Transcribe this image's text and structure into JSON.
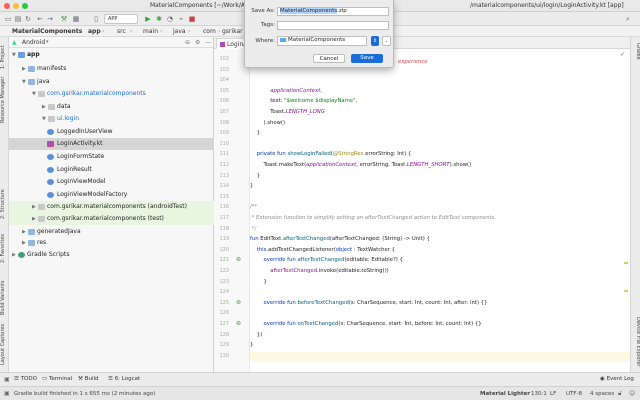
{
  "window": {
    "title": "MaterialComponents [~/Work/AndroidSample/M",
    "title_right": "/materialcomponents/ui/login/LoginActivity.kt [app]"
  },
  "toolbar": {
    "run_config": "APP"
  },
  "breadcrumb": [
    "MaterialComponents",
    "app",
    "src",
    "main",
    "java",
    "com",
    "gsrikar"
  ],
  "project_panel": {
    "view_selector": "Android",
    "tree": [
      {
        "label": "app",
        "depth": 0,
        "icon": "module-icon"
      },
      {
        "label": "manifests",
        "depth": 1,
        "icon": "folder-icon"
      },
      {
        "label": "java",
        "depth": 1,
        "icon": "folder-icon"
      },
      {
        "label": "com.gsrikar.materialcomponents",
        "depth": 2,
        "icon": "package-icon"
      },
      {
        "label": "data",
        "depth": 3,
        "icon": "folder-icon"
      },
      {
        "label": "ui.login",
        "depth": 3,
        "icon": "package-icon"
      },
      {
        "label": "LoggedInUserView",
        "depth": 4,
        "icon": "kotlin-class-icon"
      },
      {
        "label": "LoginActivity.kt",
        "depth": 4,
        "icon": "kotlin-file-icon"
      },
      {
        "label": "LoginFormState",
        "depth": 4,
        "icon": "kotlin-class-icon"
      },
      {
        "label": "LoginResult",
        "depth": 4,
        "icon": "kotlin-class-icon"
      },
      {
        "label": "LoginViewModel",
        "depth": 4,
        "icon": "kotlin-class-icon"
      },
      {
        "label": "LoginViewModelFactory",
        "depth": 4,
        "icon": "kotlin-class-icon"
      },
      {
        "label": "com.gsrikar.materialcomponents (androidTest)",
        "depth": 2,
        "icon": "package-icon"
      },
      {
        "label": "com.gsrikar.materialcomponents (test)",
        "depth": 2,
        "icon": "package-icon"
      },
      {
        "label": "generatedJava",
        "depth": 1,
        "icon": "folder-icon"
      },
      {
        "label": "res",
        "depth": 1,
        "icon": "folder-icon"
      },
      {
        "label": "Gradle Scripts",
        "depth": 0,
        "icon": "gradle-icon"
      }
    ]
  },
  "left_strip": [
    "1: Project",
    "Resource Manager",
    "2: Structure",
    "2: Favorites",
    "Build Variants",
    "Layout Captures"
  ],
  "right_strip": [
    "Gradle",
    "Device File Explorer"
  ],
  "editor": {
    "tab": "LoginActivit",
    "lines": [
      {
        "n": "102",
        "html": ""
      },
      {
        "n": "103",
        "html": ""
      },
      {
        "n": "104",
        "html": ""
      },
      {
        "n": "105",
        "html": "            <span class='it'>applicationContext</span>,"
      },
      {
        "n": "106",
        "html": "            text: <span class='str'>\"$welcome $displayName\"</span>,"
      },
      {
        "n": "107",
        "html": "            Toast.<span class='it'>LENGTH_LONG</span>"
      },
      {
        "n": "108",
        "html": "        ).show()"
      },
      {
        "n": "109",
        "html": "    }"
      },
      {
        "n": "110",
        "html": ""
      },
      {
        "n": "111",
        "html": "    <span class='kw'>private fun</span> <span class='fn'>showLoginFailed</span>(<span class='ann'>@StringRes</span> errorString: Int) {"
      },
      {
        "n": "112",
        "html": "        Toast.makeText(<span class='it'>applicationContext</span>, errorString, Toast.<span class='it'>LENGTH_SHORT</span>).show()"
      },
      {
        "n": "113",
        "html": "    }"
      },
      {
        "n": "114",
        "html": "}"
      },
      {
        "n": "115",
        "html": ""
      },
      {
        "n": "116",
        "html": "<span class='cm'>/**</span>"
      },
      {
        "n": "117",
        "html": "<span class='cm'> * Extension function to simplify setting an afterTextChanged action to EditText components.</span>"
      },
      {
        "n": "118",
        "html": "<span class='cm'> */</span>"
      },
      {
        "n": "119",
        "html": "<span class='kw'>fun</span> EditText.<span class='fn'>afterTextChanged</span>(afterTextChanged: (String) -> Unit) {"
      },
      {
        "n": "120",
        "html": "    <span class='kw'>this</span>.addTextChangedListener(<span class='kw'>object</span> : TextWatcher {"
      },
      {
        "n": "121",
        "html": "        <span class='kw'>override fun</span> <span class='fn'>afterTextChanged</span>(editable: Editable?) {"
      },
      {
        "n": "122",
        "html": "            <span class='prop'>afterTextChanged</span>.invoke(editable.toString())"
      },
      {
        "n": "123",
        "html": "        }"
      },
      {
        "n": "124",
        "html": ""
      },
      {
        "n": "125",
        "html": "        <span class='kw'>override fun</span> <span class='fn'>beforeTextChanged</span>(s: CharSequence, start: Int, count: Int, after: Int) {}"
      },
      {
        "n": "126",
        "html": ""
      },
      {
        "n": "127",
        "html": "        <span class='kw'>override fun</span> <span class='fn'>onTextChanged</span>(s: CharSequence, start: Int, before: Int, count: Int) {}"
      },
      {
        "n": "128",
        "html": "    })"
      },
      {
        "n": "129",
        "html": "}"
      },
      {
        "n": "130",
        "html": ""
      }
    ],
    "visible_fragment": "experience"
  },
  "save_dialog": {
    "save_as_label": "Save As:",
    "save_as_value": "MaterialComponents",
    "save_as_ext": ".zip",
    "tags_label": "Tags:",
    "where_label": "Where:",
    "where_value": "MaterialComponents",
    "cancel_label": "Cancel",
    "save_label": "Save"
  },
  "bottom_bar": {
    "todo": "TODO",
    "terminal": "Terminal",
    "build": "Build",
    "logcat": "6: Logcat",
    "event_log": "Event Log"
  },
  "status_bar": {
    "message": "Gradle build finished in 1 s 655 ms (2 minutes ago)",
    "theme": "Material Lighter",
    "position": "130:1",
    "line_sep": "LF",
    "encoding": "UTF-8",
    "indent": "4 spaces"
  },
  "colors": {
    "accent": "#1a6dd8",
    "selection": "#d5d5d5",
    "test_bg": "#e8f5e1"
  }
}
